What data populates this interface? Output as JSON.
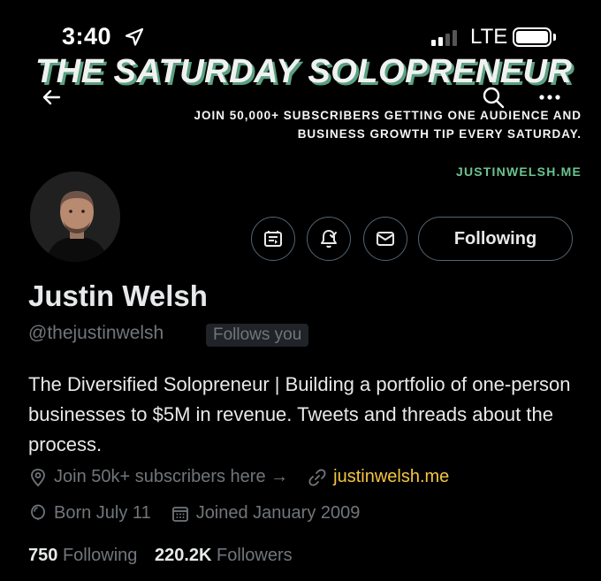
{
  "status_bar": {
    "time": "3:40",
    "network": "LTE"
  },
  "banner": {
    "title": "THE SATURDAY SOLOPRENEUR",
    "subtitle_line1": "JOIN 50,000+ SUBSCRIBERS GETTING ONE AUDIENCE AND",
    "subtitle_line2": "BUSINESS GROWTH TIP EVERY SATURDAY.",
    "link": "JUSTINWELSH.ME"
  },
  "actions": {
    "following_label": "Following"
  },
  "profile": {
    "name": "Justin Welsh",
    "handle": "@thejustinwelsh",
    "follows_you": "Follows you",
    "bio": "The Diversified Solopreneur | Building a portfolio of one-person businesses to $5M in revenue. Tweets and threads about the process.",
    "location": "Join 50k+ subscribers here →",
    "website": "justinwelsh.me",
    "birthday": "Born July 11",
    "joined": "Joined January 2009"
  },
  "stats": {
    "following_count": "750",
    "following_label": "Following",
    "followers_count": "220.2K",
    "followers_label": "Followers"
  },
  "colors": {
    "background": "#000000",
    "text_primary": "#e7e9ea",
    "text_secondary": "#71767b",
    "banner_accent": "#6cc38f",
    "link": "#f5c542"
  }
}
